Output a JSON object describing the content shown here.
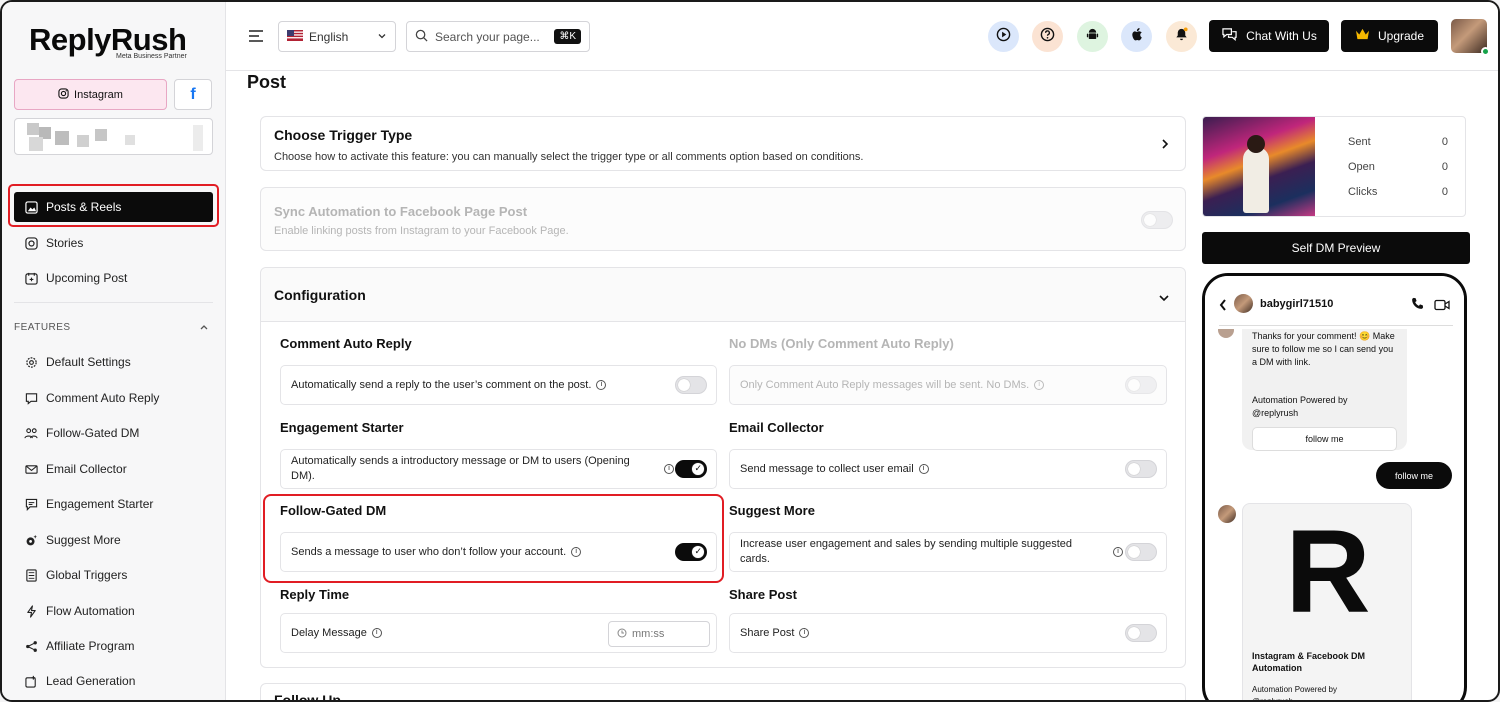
{
  "brand": {
    "name": "ReplyRush",
    "sub": "Meta Business Partner"
  },
  "sidebar": {
    "instagram_label": "Instagram",
    "fb_label": "f",
    "main_items": [
      {
        "label": "Posts & Reels",
        "icon": "image-icon"
      },
      {
        "label": "Stories",
        "icon": "instagram-icon"
      },
      {
        "label": "Upcoming Post",
        "icon": "calendar-icon"
      }
    ],
    "features_header": "FEATURES",
    "features": [
      {
        "label": "Default Settings",
        "icon": "gear-icon"
      },
      {
        "label": "Comment Auto Reply",
        "icon": "comment-icon"
      },
      {
        "label": "Follow-Gated DM",
        "icon": "users-icon"
      },
      {
        "label": "Email Collector",
        "icon": "mail-icon"
      },
      {
        "label": "Engagement Starter",
        "icon": "chat-icon"
      },
      {
        "label": "Suggest More",
        "icon": "sparkle-gear-icon"
      },
      {
        "label": "Global Triggers",
        "icon": "list-icon"
      },
      {
        "label": "Flow Automation",
        "icon": "bolt-icon"
      },
      {
        "label": "Affiliate Program",
        "icon": "share-icon"
      },
      {
        "label": "Lead Generation",
        "icon": "lead-icon"
      }
    ]
  },
  "topbar": {
    "language": "English",
    "search_placeholder": "Search your page...",
    "shortcut": "⌘K",
    "chat_button": "Chat With Us",
    "upgrade_button": "Upgrade"
  },
  "page": {
    "title": "Post"
  },
  "trigger": {
    "title": "Choose Trigger Type",
    "subtitle": "Choose how to activate this feature: you can manually select the trigger type or all comments option based on conditions."
  },
  "sync": {
    "title": "Sync Automation to Facebook Page Post",
    "subtitle": "Enable linking posts from Instagram to your Facebook Page."
  },
  "config": {
    "title": "Configuration",
    "comment_auto_reply": {
      "label": "Comment Auto Reply",
      "desc": "Automatically send a reply to the user’s comment on the post."
    },
    "no_dms": {
      "label": "No DMs (Only Comment Auto Reply)",
      "desc": "Only Comment Auto Reply messages will be sent. No DMs."
    },
    "engagement_starter": {
      "label": "Engagement Starter",
      "desc": "Automatically sends a introductory message or DM to users (Opening DM)."
    },
    "email_collector": {
      "label": "Email Collector",
      "desc": "Send message to collect user email"
    },
    "follow_gated": {
      "label": "Follow-Gated DM",
      "desc": "Sends a message to user who don’t follow your account."
    },
    "suggest_more": {
      "label": "Suggest More",
      "desc": "Increase user engagement and sales by sending multiple suggested cards."
    },
    "reply_time": {
      "label": "Reply Time",
      "desc": "Delay Message",
      "placeholder": "mm:ss"
    },
    "share_post": {
      "label": "Share Post",
      "desc": "Share Post"
    }
  },
  "follow_up": {
    "title": "Follow Up"
  },
  "stats": {
    "rows": [
      {
        "label": "Sent",
        "value": "0"
      },
      {
        "label": "Open",
        "value": "0"
      },
      {
        "label": "Clicks",
        "value": "0"
      }
    ]
  },
  "preview": {
    "button": "Self DM Preview",
    "username": "babygirl71510",
    "msg1": "Thanks for your comment! 😊 Make sure to follow me so I can send you a DM with link.",
    "powered": "Automation Powered by @replyrush",
    "follow_btn": "follow me",
    "reply": "follow me",
    "card_letter": "R",
    "card_title": "Instagram & Facebook DM Automation",
    "card_powered": "Automation Powered by @replyrush"
  },
  "colors": {
    "accent_black": "#0b0b0b",
    "highlight_red": "#e11d24",
    "ig_pink": "#fce7f0"
  }
}
